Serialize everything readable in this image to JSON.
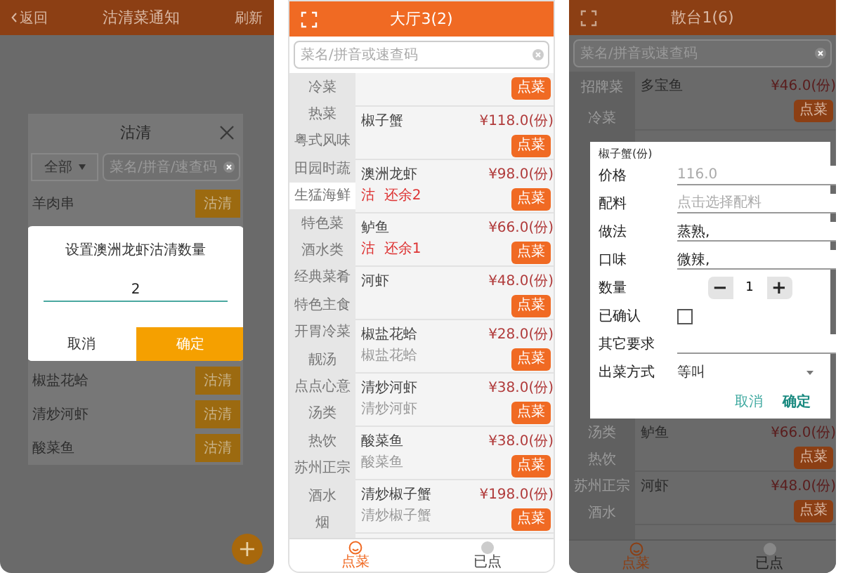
{
  "screen_1": {
    "header": {
      "back": "返回",
      "title": "沽清菜通知",
      "action": "刷新"
    },
    "panel": {
      "title": "沽清",
      "filter": "全部",
      "search_placeholder": "菜名/拼音/速查码",
      "items_above": [
        {
          "name": "羊肉串",
          "button": "沽清"
        }
      ],
      "items_below": [
        {
          "name": "椒盐花蛤",
          "button": "沽清"
        },
        {
          "name": "清炒河虾",
          "button": "沽清"
        },
        {
          "name": "酸菜鱼",
          "button": "沽清"
        }
      ]
    },
    "dialog": {
      "title": "设置澳洲龙虾沽清数量",
      "value": "2",
      "buttons": [
        {
          "label": "取消",
          "primary": false
        },
        {
          "label": "确定",
          "primary": true
        }
      ]
    },
    "fab": "+"
  },
  "screen_2": {
    "header": {
      "title": "大厅3(2)"
    },
    "search": {
      "placeholder": "菜名/拼音或速查码"
    },
    "categories": [
      {
        "label": "冷菜",
        "selected": false
      },
      {
        "label": "热菜",
        "selected": false
      },
      {
        "label": "粤式风味",
        "selected": false
      },
      {
        "label": "田园时蔬",
        "selected": false
      },
      {
        "label": "生猛海鲜",
        "selected": true
      },
      {
        "label": "特色菜",
        "selected": false
      },
      {
        "label": "酒水类",
        "selected": false
      },
      {
        "label": "经典菜肴",
        "selected": false
      },
      {
        "label": "特色主食",
        "selected": false
      },
      {
        "label": "开胃冷菜",
        "selected": false
      },
      {
        "label": "靓汤",
        "selected": false
      },
      {
        "label": "点点心意",
        "selected": false
      },
      {
        "label": "汤类",
        "selected": false
      },
      {
        "label": "热饮",
        "selected": false
      },
      {
        "label": "苏州正宗",
        "selected": false
      },
      {
        "label": "酒水",
        "selected": false
      },
      {
        "label": "烟",
        "selected": false
      }
    ],
    "dishes": [
      {
        "button": "点菜"
      },
      {
        "name": "椒子蟹",
        "price": "¥118.0(份)",
        "button": "点菜"
      },
      {
        "name": "澳洲龙虾",
        "price": "¥98.0(份)",
        "note": "沽  还余2",
        "button": "点菜"
      },
      {
        "name": "鲈鱼",
        "price": "¥66.0(份)",
        "note": "沽  还余1",
        "button": "点菜"
      },
      {
        "name": "河虾",
        "price": "¥48.0(份)",
        "button": "点菜"
      },
      {
        "name": "椒盐花蛤",
        "price": "¥28.0(份)",
        "sub": "椒盐花蛤",
        "button": "点菜"
      },
      {
        "name": "清炒河虾",
        "price": "¥38.0(份)",
        "sub": "清炒河虾",
        "button": "点菜"
      },
      {
        "name": "酸菜鱼",
        "price": "¥38.0(份)",
        "sub": "酸菜鱼",
        "button": "点菜"
      },
      {
        "name": "清炒椒子蟹",
        "price": "¥198.0(份)",
        "sub": "清炒椒子蟹",
        "button": "点菜"
      }
    ],
    "tabs": [
      {
        "label": "点菜",
        "selected": true
      },
      {
        "label": "已点",
        "selected": false
      }
    ]
  },
  "screen_3": {
    "header": {
      "title": "散台1(6)"
    },
    "search": {
      "placeholder": "菜名/拼音或速查码"
    },
    "categories_above": [
      "招牌菜",
      "冷菜"
    ],
    "dishes_above": [
      {
        "name": "多宝鱼",
        "price": "¥46.0(份)",
        "button": "点菜"
      }
    ],
    "categories_below": [
      "汤类",
      "热饮",
      "苏州正宗",
      "酒水"
    ],
    "dishes_below": [
      {
        "name": "鲈鱼",
        "price": "¥66.0(份)",
        "button": "点菜"
      },
      {
        "name": "河虾",
        "price": "¥48.0(份)",
        "button": "点菜"
      }
    ],
    "dialog": {
      "title": "椒子蟹(份)",
      "fields": [
        {
          "kind": "text",
          "label": "价格",
          "value": "116.0",
          "disabled": true
        },
        {
          "kind": "text",
          "label": "配料",
          "placeholder": "点击选择配料"
        },
        {
          "kind": "text",
          "label": "做法",
          "value": "蒸熟,"
        },
        {
          "kind": "text",
          "label": "口味",
          "value": "微辣,"
        },
        {
          "kind": "stepper",
          "label": "数量",
          "value": "1",
          "minus": "−",
          "plus": "+"
        },
        {
          "kind": "checkbox",
          "label": "已确认",
          "checked": false
        },
        {
          "kind": "text",
          "label": "其它要求"
        },
        {
          "kind": "select",
          "label": "出菜方式",
          "value": "等叫"
        }
      ],
      "buttons": [
        {
          "label": "取消",
          "primary": false
        },
        {
          "label": "确定",
          "primary": true
        }
      ]
    },
    "tabs": [
      {
        "label": "点菜",
        "selected": true
      },
      {
        "label": "已点",
        "selected": false
      }
    ]
  }
}
